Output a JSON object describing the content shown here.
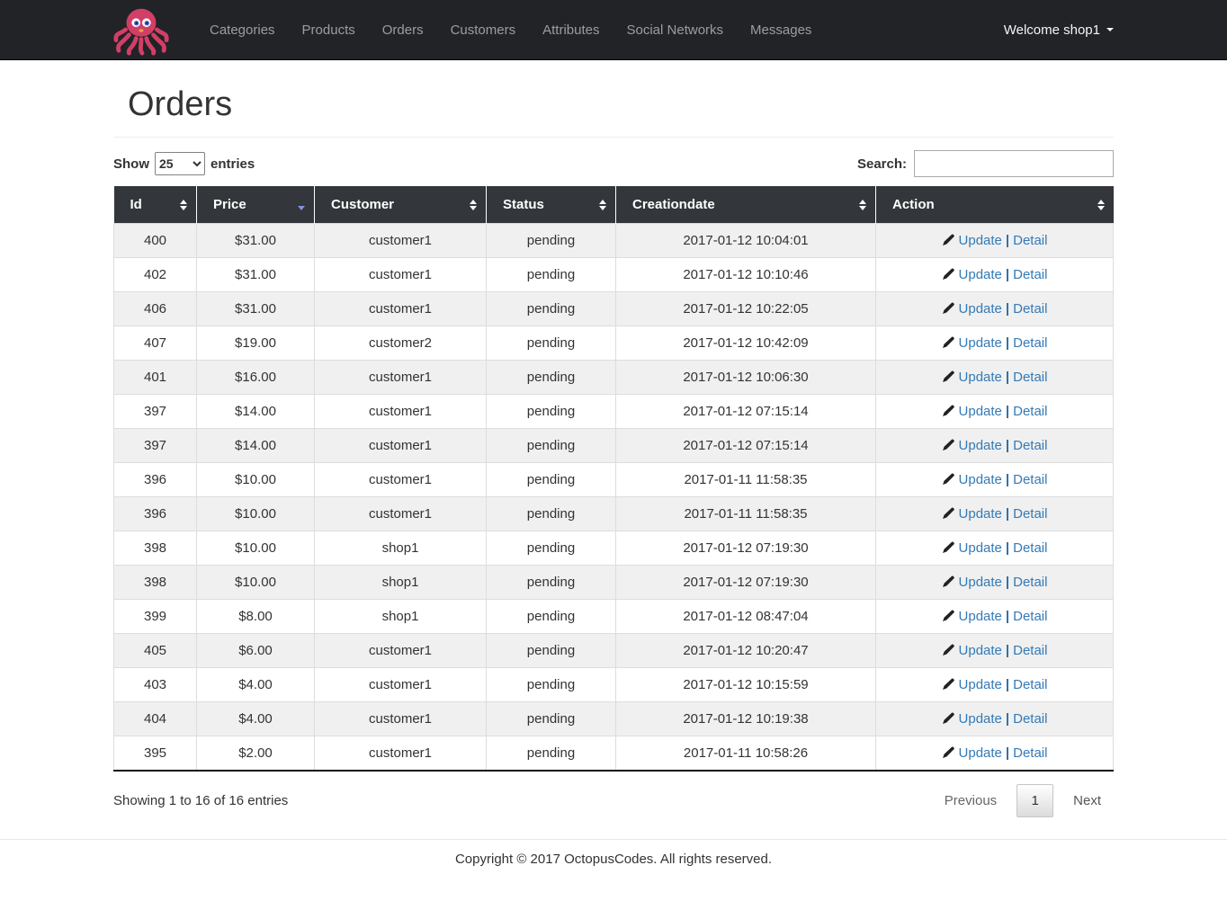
{
  "navbar": {
    "brand_name": "octopus-logo",
    "items": [
      "Categories",
      "Products",
      "Orders",
      "Customers",
      "Attributes",
      "Social Networks",
      "Messages"
    ],
    "welcome": "Welcome shop1"
  },
  "page": {
    "title": "Orders"
  },
  "controls": {
    "show_label": "Show",
    "entries_label": "entries",
    "page_size": "25",
    "search_label": "Search:",
    "search_value": ""
  },
  "table": {
    "columns": [
      {
        "key": "id",
        "label": "Id",
        "sort": "both"
      },
      {
        "key": "price",
        "label": "Price",
        "sort": "desc"
      },
      {
        "key": "customer",
        "label": "Customer",
        "sort": "both"
      },
      {
        "key": "status",
        "label": "Status",
        "sort": "both"
      },
      {
        "key": "creationdate",
        "label": "Creationdate",
        "sort": "both"
      },
      {
        "key": "action",
        "label": "Action",
        "sort": "both"
      }
    ],
    "action": {
      "update": "Update",
      "separator": "|",
      "detail": "Detail"
    },
    "rows": [
      {
        "id": "400",
        "price": "$31.00",
        "customer": "customer1",
        "status": "pending",
        "creationdate": "2017-01-12 10:04:01"
      },
      {
        "id": "402",
        "price": "$31.00",
        "customer": "customer1",
        "status": "pending",
        "creationdate": "2017-01-12 10:10:46"
      },
      {
        "id": "406",
        "price": "$31.00",
        "customer": "customer1",
        "status": "pending",
        "creationdate": "2017-01-12 10:22:05"
      },
      {
        "id": "407",
        "price": "$19.00",
        "customer": "customer2",
        "status": "pending",
        "creationdate": "2017-01-12 10:42:09"
      },
      {
        "id": "401",
        "price": "$16.00",
        "customer": "customer1",
        "status": "pending",
        "creationdate": "2017-01-12 10:06:30"
      },
      {
        "id": "397",
        "price": "$14.00",
        "customer": "customer1",
        "status": "pending",
        "creationdate": "2017-01-12 07:15:14"
      },
      {
        "id": "397",
        "price": "$14.00",
        "customer": "customer1",
        "status": "pending",
        "creationdate": "2017-01-12 07:15:14"
      },
      {
        "id": "396",
        "price": "$10.00",
        "customer": "customer1",
        "status": "pending",
        "creationdate": "2017-01-11 11:58:35"
      },
      {
        "id": "396",
        "price": "$10.00",
        "customer": "customer1",
        "status": "pending",
        "creationdate": "2017-01-11 11:58:35"
      },
      {
        "id": "398",
        "price": "$10.00",
        "customer": "shop1",
        "status": "pending",
        "creationdate": "2017-01-12 07:19:30"
      },
      {
        "id": "398",
        "price": "$10.00",
        "customer": "shop1",
        "status": "pending",
        "creationdate": "2017-01-12 07:19:30"
      },
      {
        "id": "399",
        "price": "$8.00",
        "customer": "shop1",
        "status": "pending",
        "creationdate": "2017-01-12 08:47:04"
      },
      {
        "id": "405",
        "price": "$6.00",
        "customer": "customer1",
        "status": "pending",
        "creationdate": "2017-01-12 10:20:47"
      },
      {
        "id": "403",
        "price": "$4.00",
        "customer": "customer1",
        "status": "pending",
        "creationdate": "2017-01-12 10:15:59"
      },
      {
        "id": "404",
        "price": "$4.00",
        "customer": "customer1",
        "status": "pending",
        "creationdate": "2017-01-12 10:19:38"
      },
      {
        "id": "395",
        "price": "$2.00",
        "customer": "customer1",
        "status": "pending",
        "creationdate": "2017-01-11 10:58:26"
      }
    ]
  },
  "pagination": {
    "info": "Showing 1 to 16 of 16 entries",
    "previous": "Previous",
    "current_page": "1",
    "next": "Next"
  },
  "footer": {
    "copyright": "Copyright © 2017 OctopusCodes. All rights reserved."
  },
  "colors": {
    "navbar_bg": "#212327",
    "navbar_link": "#9d9d9d",
    "table_header_bg": "#33363a",
    "row_stripe": "#f0f0f0",
    "link": "#337ab7",
    "sort_active": "#8490e2",
    "brand_pink": "#d23f66"
  }
}
